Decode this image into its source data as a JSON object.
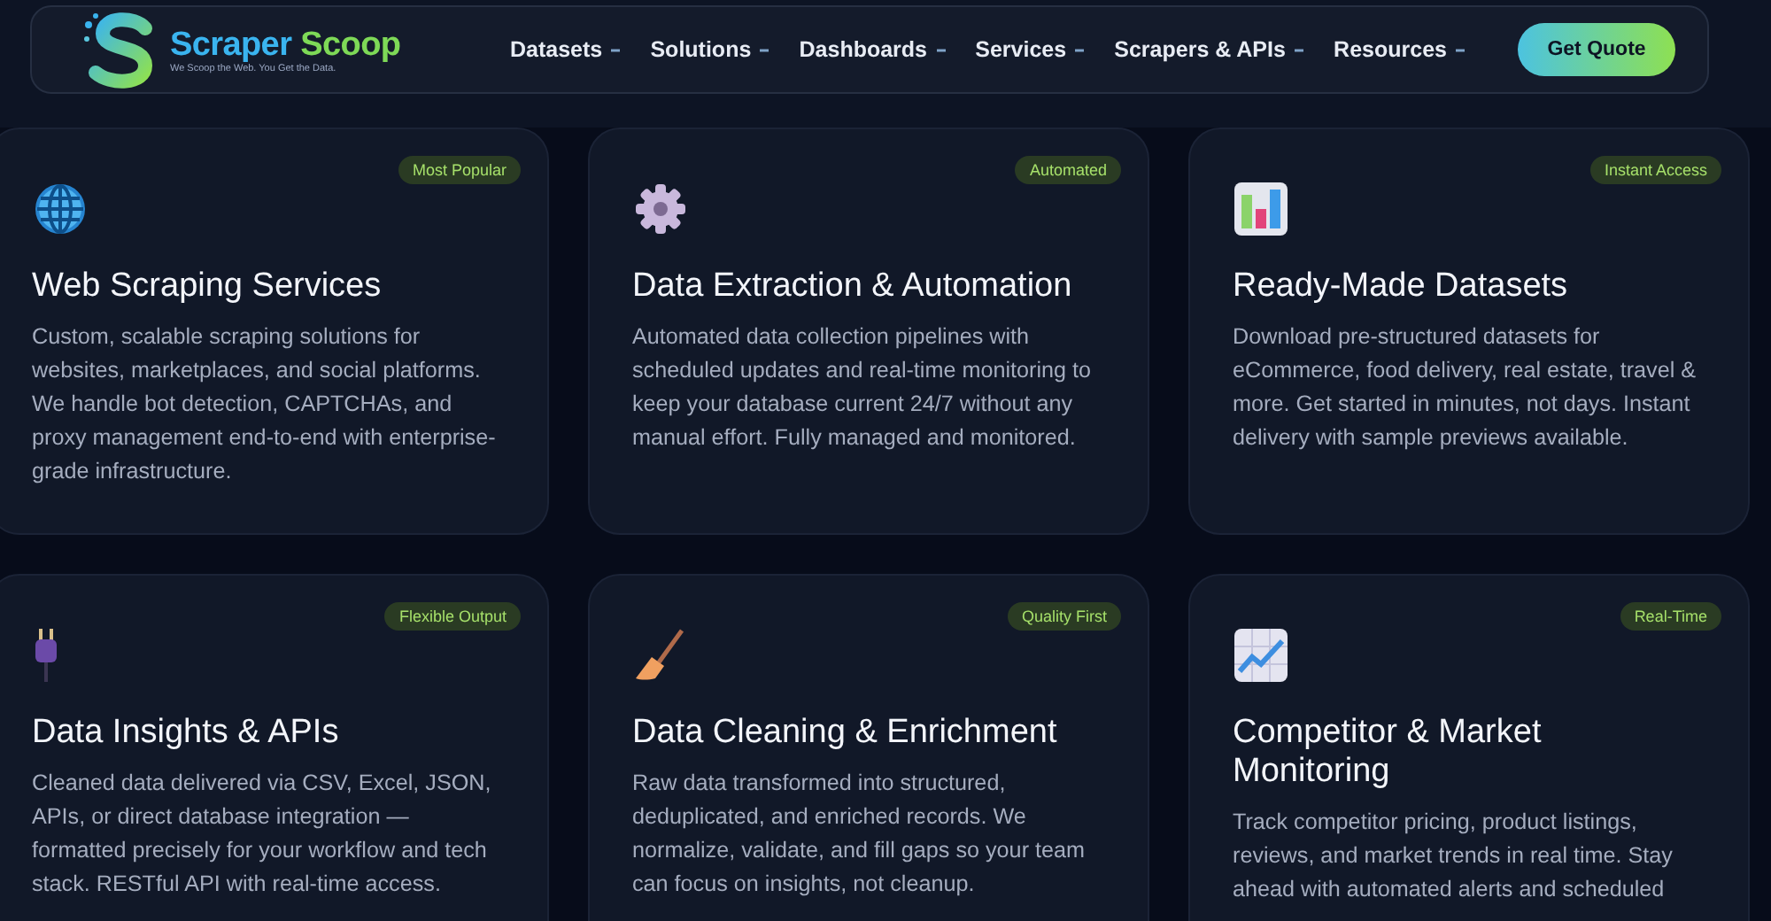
{
  "header": {
    "logo": {
      "name_first": "Scraper",
      "name_second": "Scoop",
      "tagline": "We Scoop the Web. You Get the Data."
    },
    "nav": [
      {
        "label": "Datasets"
      },
      {
        "label": "Solutions"
      },
      {
        "label": "Dashboards"
      },
      {
        "label": "Services"
      },
      {
        "label": "Scrapers & APIs"
      },
      {
        "label": "Resources"
      }
    ],
    "cta": "Get Quote"
  },
  "cards": [
    {
      "badge": "Most Popular",
      "title": "Web Scraping Services",
      "description": "Custom, scalable scraping solutions for websites, marketplaces, and social platforms. We handle bot detection, CAPTCHAs, and proxy management end-to-end with enterprise-grade infrastructure."
    },
    {
      "badge": "Automated",
      "title": "Data Extraction & Automation",
      "description": "Automated data collection pipelines with scheduled updates and real-time monitoring to keep your database current 24/7 without any manual effort. Fully managed and monitored."
    },
    {
      "badge": "Instant Access",
      "title": "Ready-Made Datasets",
      "description": "Download pre-structured datasets for eCommerce, food delivery, real estate, travel & more. Get started in minutes, not days. Instant delivery with sample previews available."
    },
    {
      "badge": "Flexible Output",
      "title": "Data Insights & APIs",
      "description": "Cleaned data delivered via CSV, Excel, JSON, APIs, or direct database integration — formatted precisely for your workflow and tech stack. RESTful API with real-time access."
    },
    {
      "badge": "Quality First",
      "title": "Data Cleaning & Enrichment",
      "description": "Raw data transformed into structured, deduplicated, and enriched records. We normalize, validate, and fill gaps so your team can focus on insights, not cleanup."
    },
    {
      "badge": "Real-Time",
      "title": "Competitor & Market Monitoring",
      "description": "Track competitor pricing, product listings, reviews, and market trends in real time. Stay ahead with automated alerts and scheduled"
    }
  ]
}
